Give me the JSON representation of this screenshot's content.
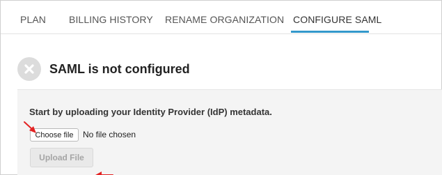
{
  "tabs": [
    {
      "label": "PLAN",
      "active": false
    },
    {
      "label": "BILLING HISTORY",
      "active": false
    },
    {
      "label": "RENAME ORGANIZATION",
      "active": false
    },
    {
      "label": "CONFIGURE SAML",
      "active": true
    }
  ],
  "status": {
    "icon": "x-circle-icon",
    "title": "SAML is not configured"
  },
  "upload": {
    "instruction": "Start by uploading your Identity Provider (IdP) metadata.",
    "choose_file_label": "Choose file",
    "file_status": "No file chosen",
    "upload_button_label": "Upload File",
    "upload_button_enabled": false
  },
  "colors": {
    "accent": "#3398cb",
    "annotation": "#e32222",
    "panel_bg": "#f4f4f4"
  }
}
